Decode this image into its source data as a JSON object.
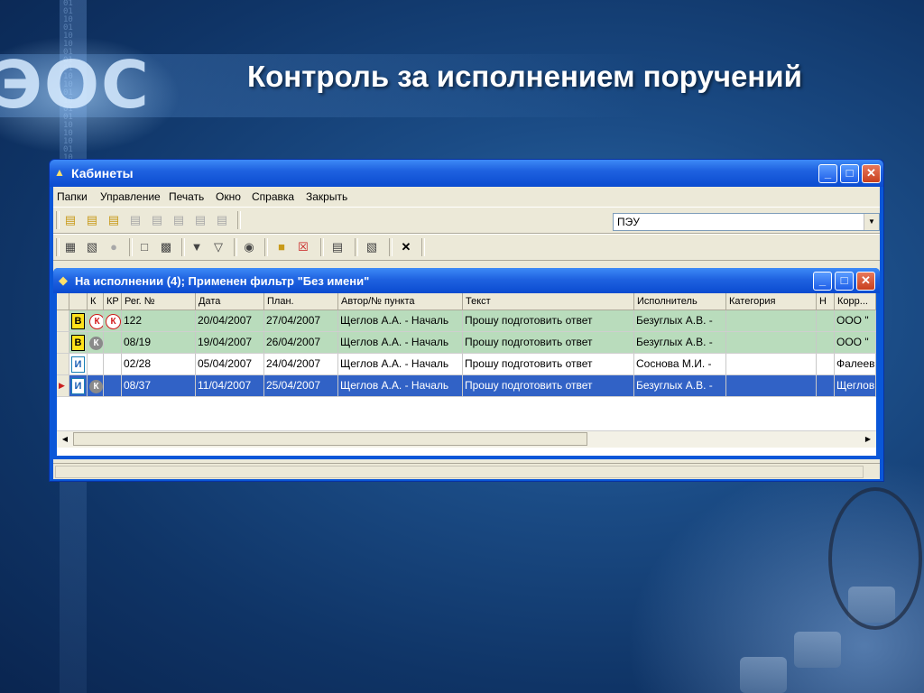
{
  "slide": {
    "title": "Контроль за исполнением поручений",
    "logo": "ЭОС"
  },
  "window": {
    "title": "Кабинеты",
    "menu": [
      "Папки",
      "Управление",
      "Печать",
      "Окно",
      "Справка",
      "Закрыть"
    ],
    "combo_value": "ПЭУ",
    "colors": {
      "titlebar": "#0a4bd0",
      "selection": "#3162c6",
      "row_green": "#b9dcbc"
    }
  },
  "inner_window": {
    "title": "На исполнении (4); Применен фильтр \"Без имени\""
  },
  "table": {
    "headers": [
      "К",
      "КР",
      "Рег. №",
      "Дата",
      "План.",
      "Автор/№ пункта",
      "Текст",
      "Исполнитель",
      "Категория",
      "Н",
      "Корр..."
    ],
    "rows": [
      {
        "badge": "В",
        "k": "К",
        "kr": "К",
        "reg": "122",
        "date": "20/04/2007",
        "plan": "27/04/2007",
        "author": "Щеглов А.А. - Началь",
        "text": "Прошу подготовить ответ",
        "executor": "Безуглых А.В. -",
        "category": "",
        "n": "",
        "corr": "ООО \"",
        "style": "green"
      },
      {
        "badge": "В",
        "k": "К",
        "kr": "",
        "reg": "08/19",
        "date": "19/04/2007",
        "plan": "26/04/2007",
        "author": "Щеглов А.А. - Началь",
        "text": "Прошу подготовить ответ",
        "executor": "Безуглых А.В. -",
        "category": "",
        "n": "",
        "corr": "ООО \"",
        "style": "green"
      },
      {
        "badge": "И",
        "k": "",
        "kr": "",
        "reg": "02/28",
        "date": "05/04/2007",
        "plan": "24/04/2007",
        "author": "Щеглов А.А. - Началь",
        "text": "Прошу подготовить ответ",
        "executor": "Соснова М.И. -",
        "category": "",
        "n": "",
        "corr": "Фалеев",
        "style": "white"
      },
      {
        "badge": "И",
        "k": "К",
        "kr": "",
        "reg": "08/37",
        "date": "11/04/2007",
        "plan": "25/04/2007",
        "author": "Щеглов А.А. - Началь",
        "text": "Прошу подготовить ответ",
        "executor": "Безуглых А.В. -",
        "category": "",
        "n": "",
        "corr": "Щеглов",
        "style": "sel"
      }
    ]
  }
}
